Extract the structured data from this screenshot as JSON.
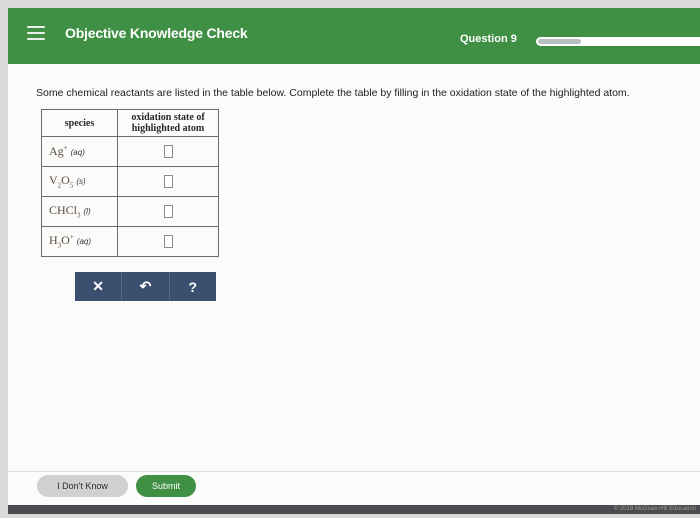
{
  "header": {
    "title": "Objective Knowledge Check",
    "question_label": "Question 9",
    "progress_fraction": 0.27
  },
  "prompt": "Some chemical reactants are listed in the table below. Complete the table by filling in the oxidation state of the highlighted atom.",
  "table": {
    "col_species": "species",
    "col_oxidation_line1": "oxidation state of",
    "col_oxidation_line2": "highlighted atom",
    "rows": [
      {
        "element": "Ag",
        "sup": "+",
        "phase": "(aq)",
        "answer": ""
      },
      {
        "element": "V",
        "sub1": "2",
        "element2": "O",
        "sub2": "5",
        "phase": "(s)",
        "answer": ""
      },
      {
        "element": "CHCl",
        "sub1": "3",
        "phase": "(l)",
        "answer": ""
      },
      {
        "element": "H",
        "sub1": "3",
        "element2": "O",
        "sup": "+",
        "phase": "(aq)",
        "answer": ""
      }
    ]
  },
  "toolbar": {
    "clear_glyph": "✕",
    "undo_glyph": "↶",
    "help_glyph": "?"
  },
  "footer": {
    "dont_know_label": "I Don't Know",
    "submit_label": "Submit",
    "copyright": "© 2018 McGraw-Hill Education"
  },
  "colors": {
    "header_green": "#3f8f44",
    "toolbar_navy": "#3b506e",
    "bottom_bar": "#4a4c4f"
  }
}
